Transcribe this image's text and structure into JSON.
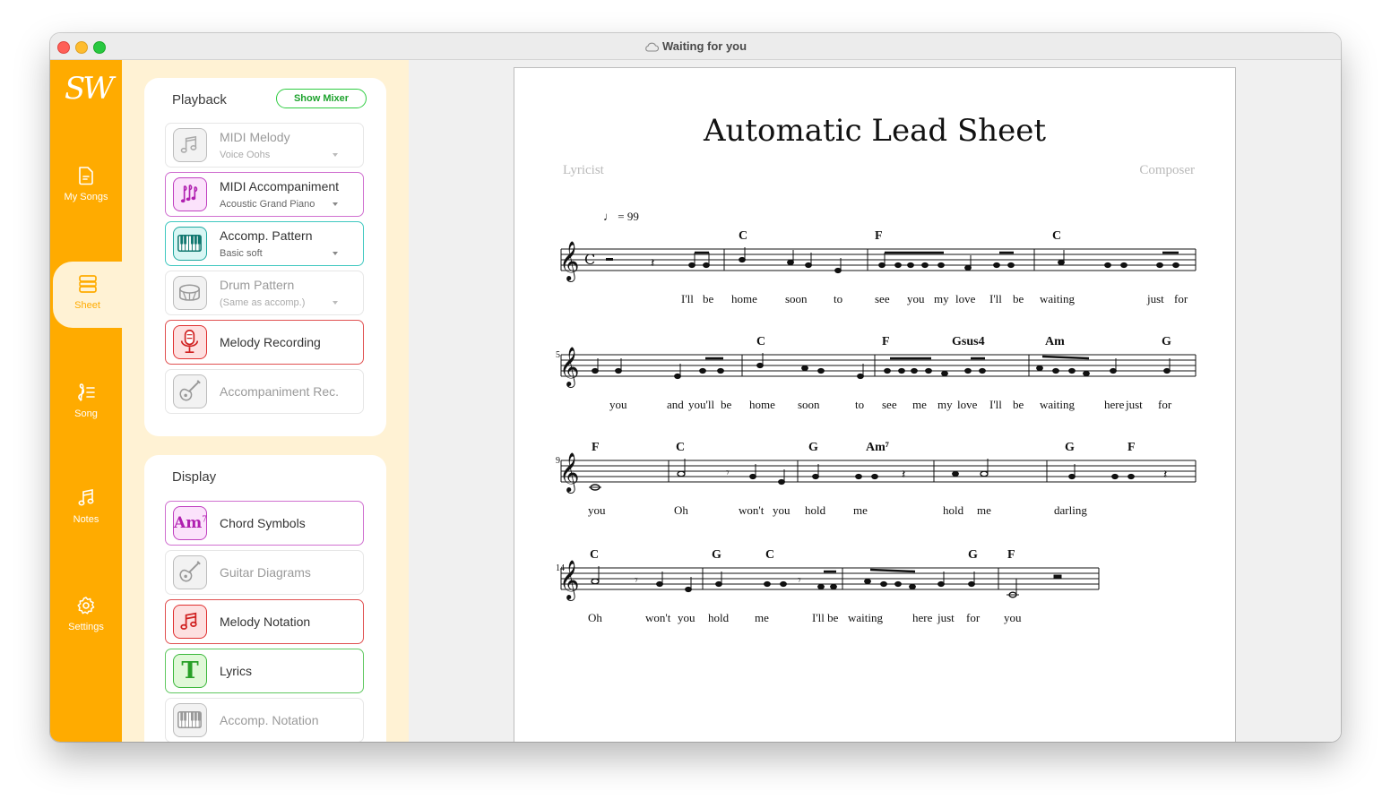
{
  "window": {
    "title": "Waiting for you"
  },
  "rail": {
    "logo": "SW",
    "items": [
      {
        "label": "My Songs",
        "icon": "document-icon"
      },
      {
        "label": "Sheet",
        "icon": "sheet-icon"
      },
      {
        "label": "Song",
        "icon": "song-structure-icon"
      },
      {
        "label": "Notes",
        "icon": "music-note-icon"
      },
      {
        "label": "Settings",
        "icon": "gear-icon"
      }
    ]
  },
  "playback": {
    "title": "Playback",
    "mixer_label": "Show Mixer",
    "items": [
      {
        "label": "MIDI Melody",
        "sub": "Voice Oohs",
        "icon": "music-note-icon",
        "enabled": false
      },
      {
        "label": "MIDI Accompaniment",
        "sub": "Acoustic Grand Piano",
        "icon": "chord-notes-icon",
        "enabled": true,
        "color": "#c030c0"
      },
      {
        "label": "Accomp. Pattern",
        "sub": "Basic soft",
        "icon": "piano-keys-icon",
        "enabled": true,
        "color": "#20b8b0"
      },
      {
        "label": "Drum Pattern",
        "sub": "(Same as accomp.)",
        "icon": "drum-icon",
        "enabled": false
      },
      {
        "label": "Melody Recording",
        "sub": "",
        "icon": "microphone-icon",
        "enabled": true,
        "color": "#e03030"
      },
      {
        "label": "Accompaniment Rec.",
        "sub": "",
        "icon": "guitar-icon",
        "enabled": false
      }
    ]
  },
  "display": {
    "title": "Display",
    "items": [
      {
        "label": "Chord Symbols",
        "icon": "chord-symbol-icon",
        "icon_text": "Am",
        "icon_sup": "7",
        "enabled": true,
        "color": "#c030c0"
      },
      {
        "label": "Guitar Diagrams",
        "icon": "guitar-icon",
        "enabled": false
      },
      {
        "label": "Melody Notation",
        "icon": "music-note-icon",
        "enabled": true,
        "color": "#e03030"
      },
      {
        "label": "Lyrics",
        "icon": "lyrics-icon",
        "icon_text": "T",
        "enabled": true,
        "color": "#3cb83c"
      },
      {
        "label": "Accomp. Notation",
        "icon": "piano-keys-icon",
        "enabled": false
      }
    ]
  },
  "sheet": {
    "title": "Automatic Lead Sheet",
    "lyricist": "Lyricist",
    "composer": "Composer",
    "tempo": "♩ = 99",
    "systems": [
      {
        "measure_number": "",
        "chords": [
          "C",
          "F",
          "C"
        ],
        "lyrics": [
          "I'll",
          "be",
          "home",
          "soon",
          "to",
          "see",
          "you",
          "my",
          "love",
          "I'll",
          "be",
          "waiting",
          "just",
          "for"
        ]
      },
      {
        "measure_number": "5",
        "chords": [
          "C",
          "F",
          "Gsus4",
          "Am",
          "G"
        ],
        "lyrics": [
          "you",
          "and",
          "you'll",
          "be",
          "home",
          "soon",
          "to",
          "see",
          "me",
          "my",
          "love",
          "I'll",
          "be",
          "waiting",
          "here",
          "just",
          "for"
        ]
      },
      {
        "measure_number": "9",
        "chords": [
          "F",
          "C",
          "G",
          "Am⁷",
          "G",
          "F"
        ],
        "lyrics": [
          "you",
          "Oh",
          "won't",
          "you",
          "hold",
          "me",
          "hold",
          "me",
          "darling"
        ]
      },
      {
        "measure_number": "14",
        "chords": [
          "C",
          "G",
          "C",
          "G",
          "F"
        ],
        "lyrics": [
          "Oh",
          "won't",
          "you",
          "hold",
          "me",
          "I'll be",
          "waiting",
          "here",
          "just",
          "for",
          "you"
        ]
      }
    ]
  },
  "colors": {
    "accent": "#ffab00",
    "panel_bg": "#fff2d4",
    "mixer_green": "#2ecc40"
  }
}
